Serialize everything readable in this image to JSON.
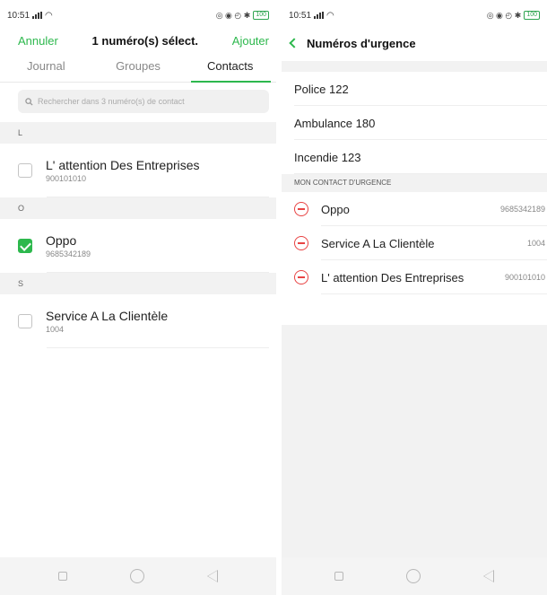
{
  "left": {
    "status": {
      "time": "10:51",
      "battery": "100"
    },
    "header": {
      "cancel": "Annuler",
      "title": "1 numéro(s) sélect.",
      "add": "Ajouter"
    },
    "tabs": [
      "Journal",
      "Groupes",
      "Contacts"
    ],
    "active_tab": "Contacts",
    "search": {
      "placeholder": "Rechercher dans 3 numéro(s) de contact",
      "icon": "search-icon"
    },
    "sections": [
      {
        "letter": "L",
        "contacts": [
          {
            "name": "L' attention Des Entreprises",
            "number": "900101010",
            "checked": false
          }
        ]
      },
      {
        "letter": "O",
        "contacts": [
          {
            "name": "Oppo",
            "number": "9685342189",
            "checked": true
          }
        ]
      },
      {
        "letter": "S",
        "contacts": [
          {
            "name": "Service A La Clientèle",
            "number": "1004",
            "checked": false
          }
        ]
      }
    ]
  },
  "right": {
    "status": {
      "time": "10:51",
      "battery": "100"
    },
    "header": {
      "title": "Numéros d'urgence"
    },
    "emergency_numbers": [
      "Police 122",
      "Ambulance 180",
      "Incendie 123"
    ],
    "section_label": "MON CONTACT D'URGENCE",
    "my_contacts": [
      {
        "name": "Oppo",
        "number": "9685342189"
      },
      {
        "name": "Service A La Clientèle",
        "number": "1004"
      },
      {
        "name": "L' attention Des Entreprises",
        "number": "900101010"
      }
    ]
  },
  "colors": {
    "accent": "#2db84d",
    "remove": "#e84343"
  }
}
